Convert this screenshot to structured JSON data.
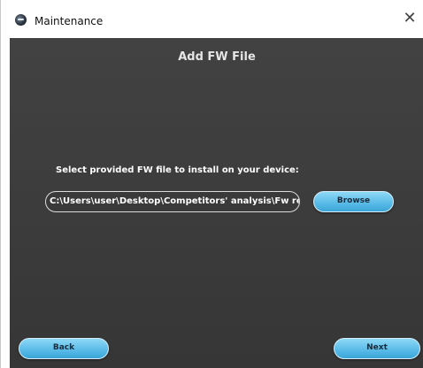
{
  "window": {
    "title": "Maintenance",
    "close_glyph": "✕"
  },
  "page": {
    "title": "Add FW File",
    "instruction": "Select provided FW file to install on your device:",
    "file_path_value": "C:\\Users\\user\\Desktop\\Competitors' analysis\\Fw revs_"
  },
  "buttons": {
    "browse_label": "Browse",
    "back_label": "Back",
    "next_label": "Next"
  },
  "colors": {
    "content_background": "#3e3e3e",
    "button_accent": "#5bbce8",
    "text_light": "#ffffff"
  },
  "icons": {
    "app": "app-logo-icon",
    "close": "close-icon"
  }
}
